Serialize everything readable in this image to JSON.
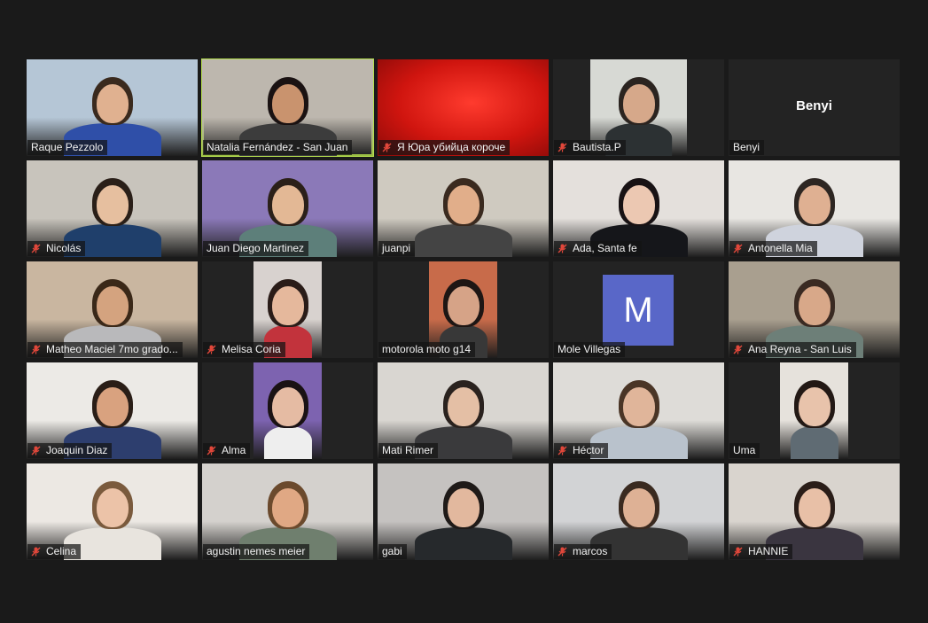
{
  "participants": [
    {
      "name": "Raque Pezzolo",
      "muted": false,
      "active": false,
      "avatar_letter": "",
      "video": "full",
      "bg": "#b5c6d6",
      "skin": "#e0b190",
      "hair": "#3a2a1e",
      "shirt": "#2f4fa8"
    },
    {
      "name": "Natalia Fernández - San Juan",
      "muted": false,
      "active": true,
      "avatar_letter": "",
      "video": "full",
      "bg": "#bdb7ae",
      "skin": "#c9936e",
      "hair": "#1a1212",
      "shirt": "#3c3c3c"
    },
    {
      "name": "Я Юра убийца короче",
      "muted": true,
      "active": false,
      "avatar_letter": "",
      "video": "art",
      "bg": "#d0150f",
      "skin": "#111",
      "hair": "#111",
      "shirt": "#222"
    },
    {
      "name": "Bautista.P",
      "muted": true,
      "active": false,
      "avatar_letter": "",
      "video": "mid",
      "bg": "#d7d9d4",
      "skin": "#d6a88a",
      "hair": "#2b2420",
      "shirt": "#2c3133"
    },
    {
      "name": "Benyi",
      "muted": false,
      "active": false,
      "avatar_letter": "",
      "video": "none",
      "bg": "",
      "skin": "",
      "hair": "",
      "shirt": ""
    },
    {
      "name": "Nicolás",
      "muted": true,
      "active": false,
      "avatar_letter": "",
      "video": "full",
      "bg": "#c8c4bc",
      "skin": "#e6bf9f",
      "hair": "#2a1f18",
      "shirt": "#1f3f6b"
    },
    {
      "name": "Juan Diego Martinez",
      "muted": false,
      "active": false,
      "avatar_letter": "",
      "video": "full",
      "bg": "#8b79b8",
      "skin": "#e3b895",
      "hair": "#2b2019",
      "shirt": "#5d7f7a"
    },
    {
      "name": "juanpi",
      "muted": false,
      "active": false,
      "avatar_letter": "",
      "video": "full",
      "bg": "#cfcac0",
      "skin": "#e1ae8a",
      "hair": "#3a2a1f",
      "shirt": "#444"
    },
    {
      "name": "Ada, Santa fe",
      "muted": true,
      "active": false,
      "avatar_letter": "",
      "video": "full",
      "bg": "#e4e0dc",
      "skin": "#ecc8b2",
      "hair": "#181214",
      "shirt": "#15161a"
    },
    {
      "name": "Antonella Mia",
      "muted": true,
      "active": false,
      "avatar_letter": "",
      "video": "full",
      "bg": "#e8e6e2",
      "skin": "#dfb092",
      "hair": "#2d2622",
      "shirt": "#cfd3dd"
    },
    {
      "name": "Matheo Maciel 7mo grado...",
      "muted": true,
      "active": false,
      "avatar_letter": "",
      "video": "full",
      "bg": "#c9b6a0",
      "skin": "#d4a37f",
      "hair": "#3a2818",
      "shirt": "#b9b9bb"
    },
    {
      "name": "Melisa Coria",
      "muted": true,
      "active": false,
      "avatar_letter": "",
      "video": "narrow",
      "bg": "#d8d2cf",
      "skin": "#e5b89c",
      "hair": "#2a1c18",
      "shirt": "#c2333c"
    },
    {
      "name": "motorola moto g14",
      "muted": false,
      "active": false,
      "avatar_letter": "",
      "video": "narrow",
      "bg": "#c86b4a",
      "skin": "#d6a387",
      "hair": "#1e1614",
      "shirt": "#383838"
    },
    {
      "name": "Mole Villegas",
      "muted": false,
      "active": false,
      "avatar_letter": "M",
      "video": "avatar",
      "bg": "",
      "skin": "",
      "hair": "",
      "shirt": ""
    },
    {
      "name": "Ana Reyna - San Luis",
      "muted": true,
      "active": false,
      "avatar_letter": "",
      "video": "full",
      "bg": "#a99f8f",
      "skin": "#d8a889",
      "hair": "#3a2a22",
      "shirt": "#6d7f78"
    },
    {
      "name": "Joaquin Diaz",
      "muted": true,
      "active": false,
      "avatar_letter": "",
      "video": "full",
      "bg": "#eceae6",
      "skin": "#d9a27f",
      "hair": "#2a1e17",
      "shirt": "#2d3e6e"
    },
    {
      "name": "Alma",
      "muted": true,
      "active": false,
      "avatar_letter": "",
      "video": "narrow",
      "bg": "#7d63b0",
      "skin": "#e5bba3",
      "hair": "#1a1214",
      "shirt": "#eee"
    },
    {
      "name": "Mati Rimer",
      "muted": false,
      "active": false,
      "avatar_letter": "",
      "video": "full",
      "bg": "#d9d6d1",
      "skin": "#e4bfa5",
      "hair": "#2a221e",
      "shirt": "#3a3a3c"
    },
    {
      "name": "Héctor",
      "muted": true,
      "active": false,
      "avatar_letter": "",
      "video": "full",
      "bg": "#dedcd8",
      "skin": "#e0b59a",
      "hair": "#4a3526",
      "shirt": "#b9c2cc"
    },
    {
      "name": "Uma",
      "muted": false,
      "active": false,
      "avatar_letter": "",
      "video": "narrow",
      "bg": "#e6e2dc",
      "skin": "#e8c3ab",
      "hair": "#231915",
      "shirt": "#5f6b73"
    },
    {
      "name": "Celina",
      "muted": true,
      "active": false,
      "avatar_letter": "",
      "video": "full",
      "bg": "#ece8e3",
      "skin": "#ecc3a8",
      "hair": "#7a5a3d",
      "shirt": "#e8e4de"
    },
    {
      "name": "agustin nemes meier",
      "muted": false,
      "active": false,
      "avatar_letter": "",
      "video": "full",
      "bg": "#d4d1cd",
      "skin": "#e0a884",
      "hair": "#6b4a2d",
      "shirt": "#6f7f6e"
    },
    {
      "name": "gabi",
      "muted": false,
      "active": false,
      "avatar_letter": "",
      "video": "full",
      "bg": "#c5c2c0",
      "skin": "#e2b89e",
      "hair": "#1f1a18",
      "shirt": "#26292c"
    },
    {
      "name": "marcos",
      "muted": true,
      "active": false,
      "avatar_letter": "",
      "video": "full",
      "bg": "#d2d3d5",
      "skin": "#deb195",
      "hair": "#3a2a20",
      "shirt": "#333"
    },
    {
      "name": "HANNIE",
      "muted": true,
      "active": false,
      "avatar_letter": "",
      "video": "full",
      "bg": "#d9d4ce",
      "skin": "#e8c0a7",
      "hair": "#2a1d18",
      "shirt": "#3a3540"
    }
  ],
  "colors": {
    "active_border": "#b6e04f",
    "muted_icon": "#e0473a",
    "avatar_bg": "#5967c8"
  }
}
